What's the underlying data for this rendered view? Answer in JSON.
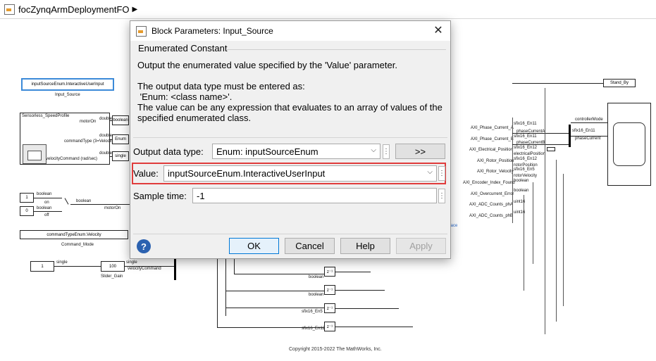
{
  "model": {
    "breadcrumb": "focZynqArmDeploymentFO",
    "copyright": "Copyright 2015-2022 The MathWorks, Inc."
  },
  "canvas": {
    "input_source_block": "inputSourceEnum.InteractiveUserInput",
    "input_source_label": "Input_Source",
    "sensorless_title": "Sensorless_SpeedProfile",
    "motor_on": "motorOn",
    "command_type": "commandType (3=Velocity)",
    "velocity_command": "velocityCommand (rad/sec)",
    "boolean": "boolean",
    "double": "double",
    "enum": "Enum",
    "single": "single",
    "const_1": "1",
    "const_0": "0",
    "on": "on",
    "off": "off",
    "motor_on_right": "motorOn",
    "command_enum": "commandTypeEnum.Velocity",
    "command_mode": "Command_Mode",
    "slider_gain": "Slider_Gain",
    "gain_value": "100",
    "velocity_command_out": "velocityCommand",
    "uint16": "uint16",
    "delay_text": "z⁻¹",
    "sfix16_en5": "sfix16_En5",
    "sfix16_en12": "sfix16_En12",
    "sfix16_en11": "sfix16_En11",
    "axi_labels": [
      "AXI_Phase_Current_A",
      "AXI_Phase_Current_B",
      "AXI_Electrical_Position",
      "AXI_Rotor_Position",
      "AXI_Rotor_Velocity",
      "AXI_Encoder_Index_Found",
      "AXI_Overcurrent_Error",
      "AXI_ADC_Counts_phA",
      "AXI_ADC_Counts_phB"
    ],
    "phase_current_a": "phaseCurrentA",
    "phase_current_b": "phaseCurrentB",
    "electrical_position": "electricalPosition",
    "rotor_position": "rotorPosition",
    "rotor_velocity": "rotorVelocity",
    "controller_mode": "controllerMode",
    "phase_current": "phaseCurrent",
    "stand_by": "Stand_By",
    "rface": "rface"
  },
  "dialog": {
    "title": "Block Parameters: Input_Source",
    "group_title": "Enumerated Constant",
    "description_1": "Output the enumerated value specified by the 'Value' parameter.",
    "description_2": "The output data type must be entered as:",
    "description_3": " 'Enum: <class name>'.",
    "description_4": "The value can be any expression that evaluates to an array of values of the specified enumerated class.",
    "output_data_type_label": "Output data type:",
    "output_data_type_value": "Enum: inputSourceEnum",
    "arrow_button": ">>",
    "value_label": "Value:",
    "value_value": "inputSourceEnum.InteractiveUserInput",
    "sample_time_label": "Sample time:",
    "sample_time_value": "-1",
    "ok": "OK",
    "cancel": "Cancel",
    "help": "Help",
    "apply": "Apply"
  },
  "colors": {
    "highlight": "#e03c3c",
    "dialog_bg": "#f0f0f0"
  }
}
